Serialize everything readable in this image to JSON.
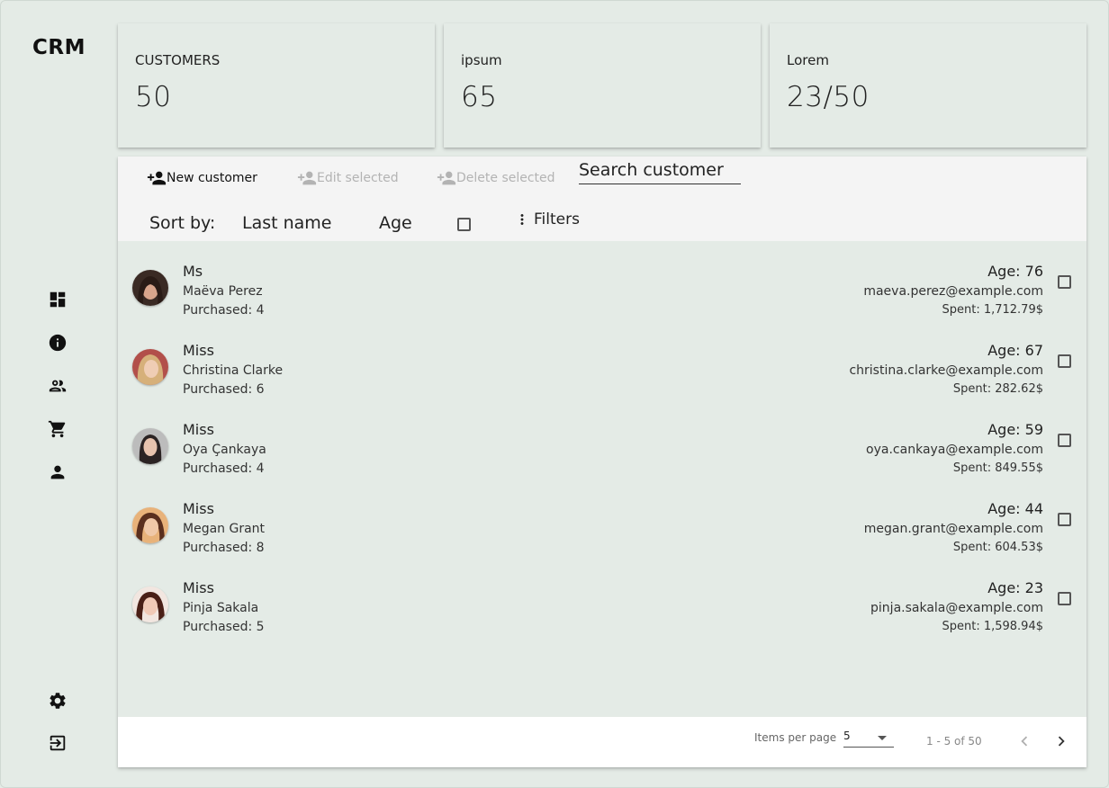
{
  "app": {
    "logo": "CRM"
  },
  "sidebar": {
    "icons": [
      "dashboard-icon",
      "info-icon",
      "people-icon",
      "cart-icon",
      "person-icon"
    ],
    "bottom_icons": [
      "gear-icon",
      "logout-icon"
    ]
  },
  "stats": [
    {
      "label": "CUSTOMERS",
      "value": "50"
    },
    {
      "label": "ipsum",
      "value": "65"
    },
    {
      "label": "Lorem",
      "value": "23/50"
    }
  ],
  "toolbar": {
    "new_label": "New customer",
    "edit_label": "Edit selected",
    "delete_label": "Delete selected",
    "search_placeholder": "Search customer"
  },
  "sort": {
    "label": "Sort by:",
    "options": [
      "Last name",
      "Age"
    ],
    "filters_label": "Filters"
  },
  "customers": [
    {
      "title": "Ms",
      "name": "Maëva Perez",
      "purchased": "Purchased: 4",
      "age": "Age: 76",
      "email": "maeva.perez@example.com",
      "spent": "Spent: 1,712.79$"
    },
    {
      "title": "Miss",
      "name": "Christina Clarke",
      "purchased": "Purchased: 6",
      "age": "Age: 67",
      "email": "christina.clarke@example.com",
      "spent": "Spent: 282.62$"
    },
    {
      "title": "Miss",
      "name": "Oya Çankaya",
      "purchased": "Purchased: 4",
      "age": "Age: 59",
      "email": "oya.cankaya@example.com",
      "spent": "Spent: 849.55$"
    },
    {
      "title": "Miss",
      "name": "Megan Grant",
      "purchased": "Purchased: 8",
      "age": "Age: 44",
      "email": "megan.grant@example.com",
      "spent": "Spent: 604.53$"
    },
    {
      "title": "Miss",
      "name": "Pinja Sakala",
      "purchased": "Purchased: 5",
      "age": "Age: 23",
      "email": "pinja.sakala@example.com",
      "spent": "Spent: 1,598.94$"
    }
  ],
  "pagination": {
    "items_per_page_label": "Items per page",
    "items_per_page_value": "5",
    "range": "1 - 5 of 50"
  },
  "colors": {
    "background": "#e4ebe6",
    "toolbar": "#f4f4f4",
    "disabled": "#b3b3b3"
  }
}
